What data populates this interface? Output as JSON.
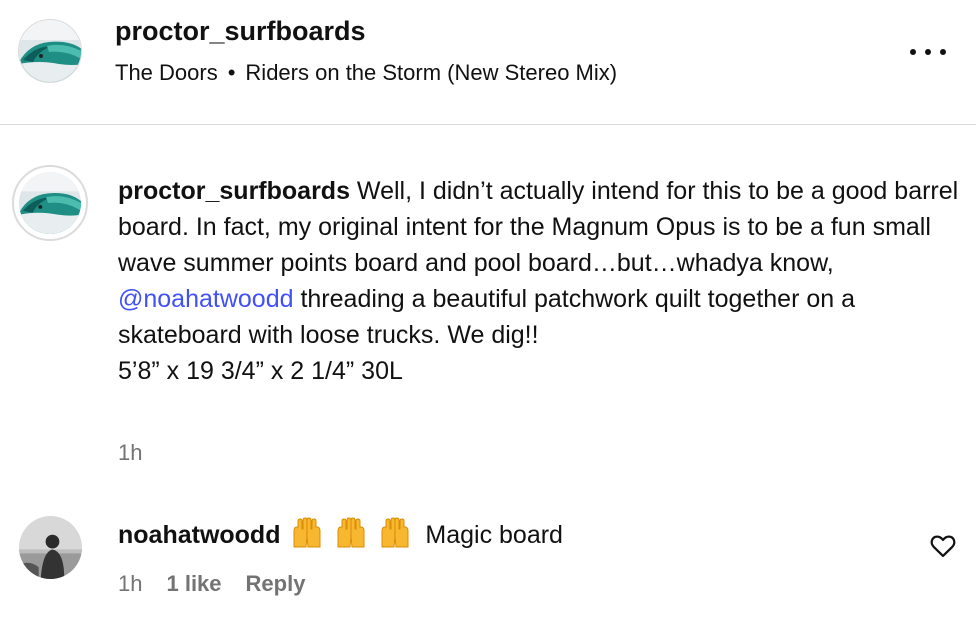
{
  "header": {
    "username": "proctor_surfboards",
    "audio_artist": "The Doors",
    "audio_separator": "•",
    "audio_track": "Riders on the Storm (New Stereo Mix)",
    "more_icon": "more-horizontal-icon"
  },
  "caption": {
    "username": "proctor_surfboards",
    "text_part1": " Well, I didn’t actually intend for this to be a good barrel board. In fact, my original intent for the Magnum Opus is to be a fun small wave summer points board and pool board…but…whadya know, ",
    "mention": "@noahatwoodd",
    "text_part2": " threading a beautiful patchwork quilt together on a skateboard with loose trucks. We dig!!",
    "dimensions": "5’8” x 19 3/4” x 2 1/4” 30L",
    "time": "1h"
  },
  "comment": {
    "username": "noahatwoodd",
    "emoji_icon": "raising-hands-emoji",
    "emoji_count": 3,
    "text": "Magic board",
    "time": "1h",
    "likes": "1 like",
    "reply_label": "Reply",
    "like_icon": "heart-outline-icon"
  },
  "colors": {
    "mention": "#4150f7",
    "muted_text": "#737373",
    "divider": "#dbdbdb"
  }
}
